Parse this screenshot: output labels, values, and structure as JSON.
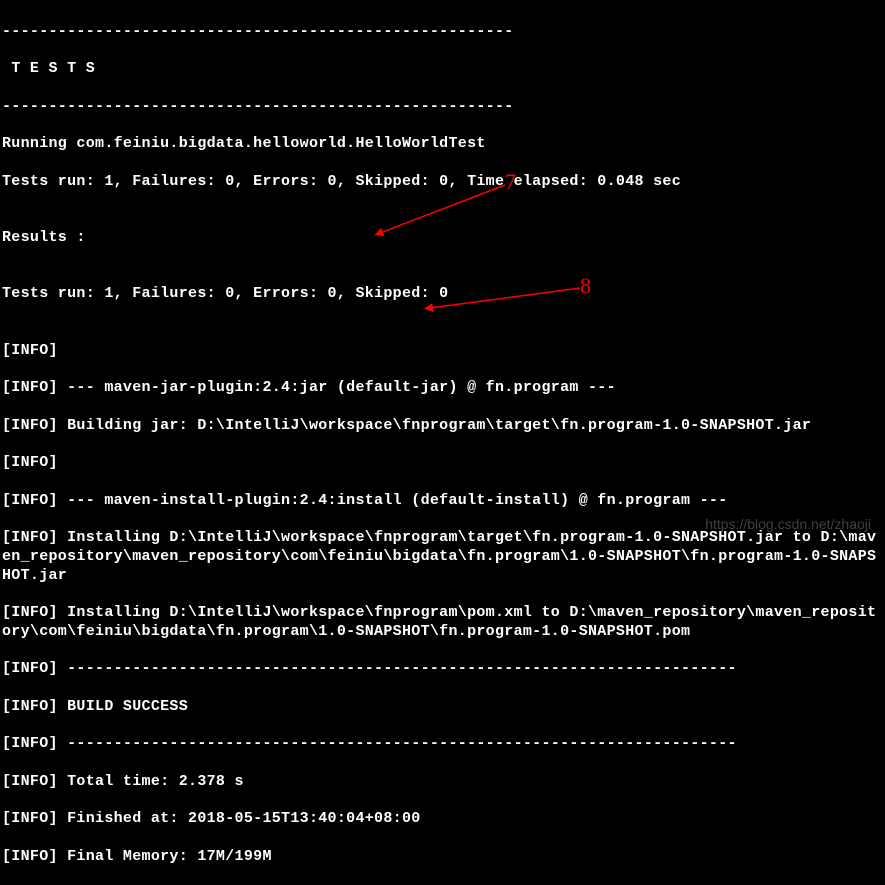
{
  "terminal": {
    "lines": [
      "-------------------------------------------------------",
      " T E S T S",
      "-------------------------------------------------------",
      "Running com.feiniu.bigdata.helloworld.HelloWorldTest",
      "Tests run: 1, Failures: 0, Errors: 0, Skipped: 0, Time elapsed: 0.048 sec",
      "",
      "Results :",
      "",
      "Tests run: 1, Failures: 0, Errors: 0, Skipped: 0",
      "",
      "[INFO]",
      "[INFO] --- maven-jar-plugin:2.4:jar (default-jar) @ fn.program ---",
      "[INFO] Building jar: D:\\IntelliJ\\workspace\\fnprogram\\target\\fn.program-1.0-SNAPSHOT.jar",
      "[INFO]",
      "[INFO] --- maven-install-plugin:2.4:install (default-install) @ fn.program ---",
      "[INFO] Installing D:\\IntelliJ\\workspace\\fnprogram\\target\\fn.program-1.0-SNAPSHOT.jar to D:\\maven_repository\\maven_repository\\com\\feiniu\\bigdata\\fn.program\\1.0-SNAPSHOT\\fn.program-1.0-SNAPSHOT.jar",
      "[INFO] Installing D:\\IntelliJ\\workspace\\fnprogram\\pom.xml to D:\\maven_repository\\maven_repository\\com\\feiniu\\bigdata\\fn.program\\1.0-SNAPSHOT\\fn.program-1.0-SNAPSHOT.pom",
      "[INFO] ------------------------------------------------------------------------",
      "[INFO] BUILD SUCCESS",
      "[INFO] ------------------------------------------------------------------------",
      "[INFO] Total time: 2.378 s",
      "[INFO] Finished at: 2018-05-15T13:40:04+08:00",
      "[INFO] Final Memory: 17M/199M"
    ]
  },
  "annotations": {
    "label7": "7",
    "label8": "8"
  },
  "watermark": "https://blog.csdn.net/zhaoji"
}
